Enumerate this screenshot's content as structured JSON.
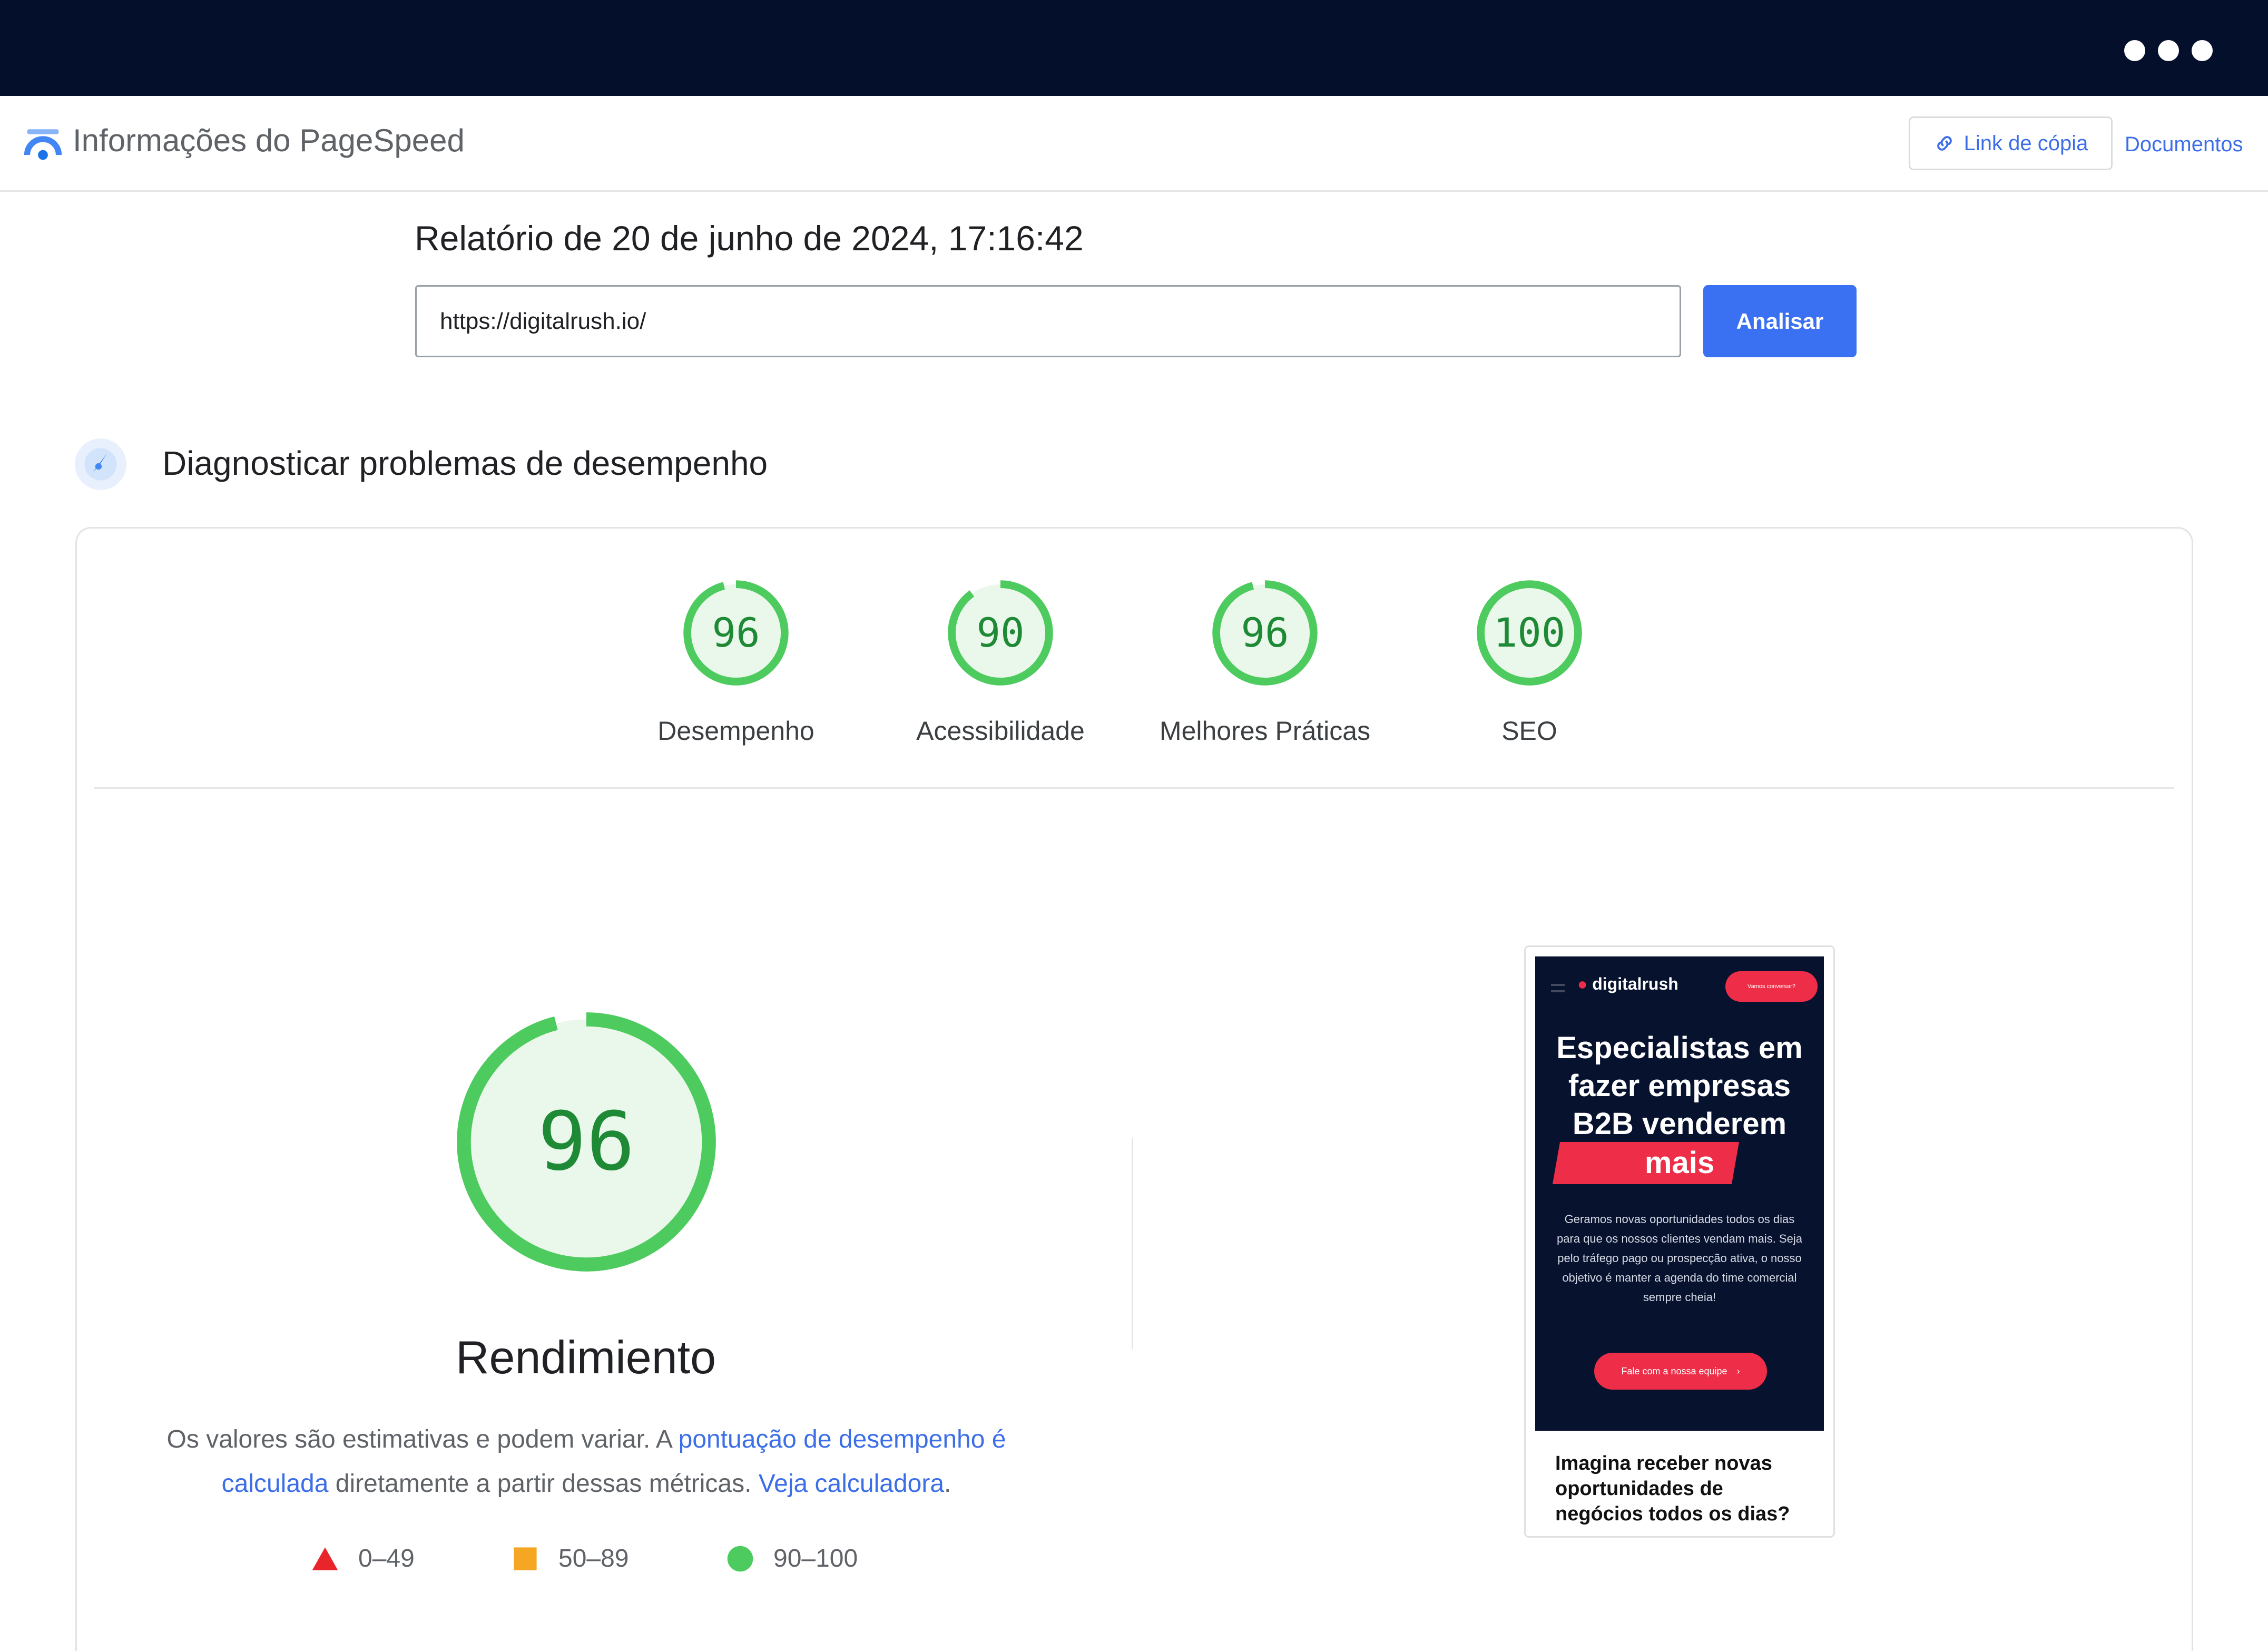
{
  "app": {
    "title": "Informações do PageSpeed",
    "copy_link_label": "Link de cópia",
    "docs_label": "Documentos"
  },
  "report": {
    "date_label": "Relatório de 20 de junho de 2024, 17:16:42",
    "url_value": "https://digitalrush.io/",
    "analyze_label": "Analisar"
  },
  "diagnostics": {
    "title": "Diagnosticar problemas de desempenho"
  },
  "scores": [
    {
      "label": "Desempenho",
      "value": "96",
      "fraction": 0.96
    },
    {
      "label": "Acessibilidade",
      "value": "90",
      "fraction": 0.9
    },
    {
      "label": "Melhores Práticas",
      "value": "96",
      "fraction": 0.96
    },
    {
      "label": "SEO",
      "value": "100",
      "fraction": 1.0
    }
  ],
  "performance": {
    "score": "96",
    "fraction": 0.96,
    "title": "Rendimiento",
    "desc_prefix": "Os valores são estimativas e podem variar. A ",
    "desc_link1": "pontuação de desempenho é calculada",
    "desc_middle": " diretamente a partir dessas métricas. ",
    "desc_link2": "Veja calculadora",
    "desc_suffix": "."
  },
  "legend": [
    {
      "label": "0–49",
      "shape": "triangle",
      "color": "#e8252b"
    },
    {
      "label": "50–89",
      "shape": "square",
      "color": "#f5a623"
    },
    {
      "label": "90–100",
      "shape": "circle",
      "color": "#4ecb5e"
    }
  ],
  "screenshot": {
    "logo_text": "digitalrush",
    "top_cta": "Vamos conversar?",
    "headline": "Especialistas em fazer empresas B2B venderem",
    "headline_accent": "mais",
    "body": "Geramos novas oportunidades todos os dias para que os nossos clientes vendam mais. Seja pelo tráfego pago ou prospecção ativa, o nosso objetivo é manter a agenda do time comercial sempre cheia!",
    "cta": "Fale com a nossa equipe",
    "caption": "Imagina receber novas oportunidades de negócios todos os dias?"
  },
  "colors": {
    "window_bar": "#040f2c",
    "accent_blue": "#3a71f3",
    "score_green": "#1e8a35",
    "ring_green": "#4ecb5e",
    "ring_fill": "#eaf8ec",
    "brand_red": "#ee2e48"
  }
}
